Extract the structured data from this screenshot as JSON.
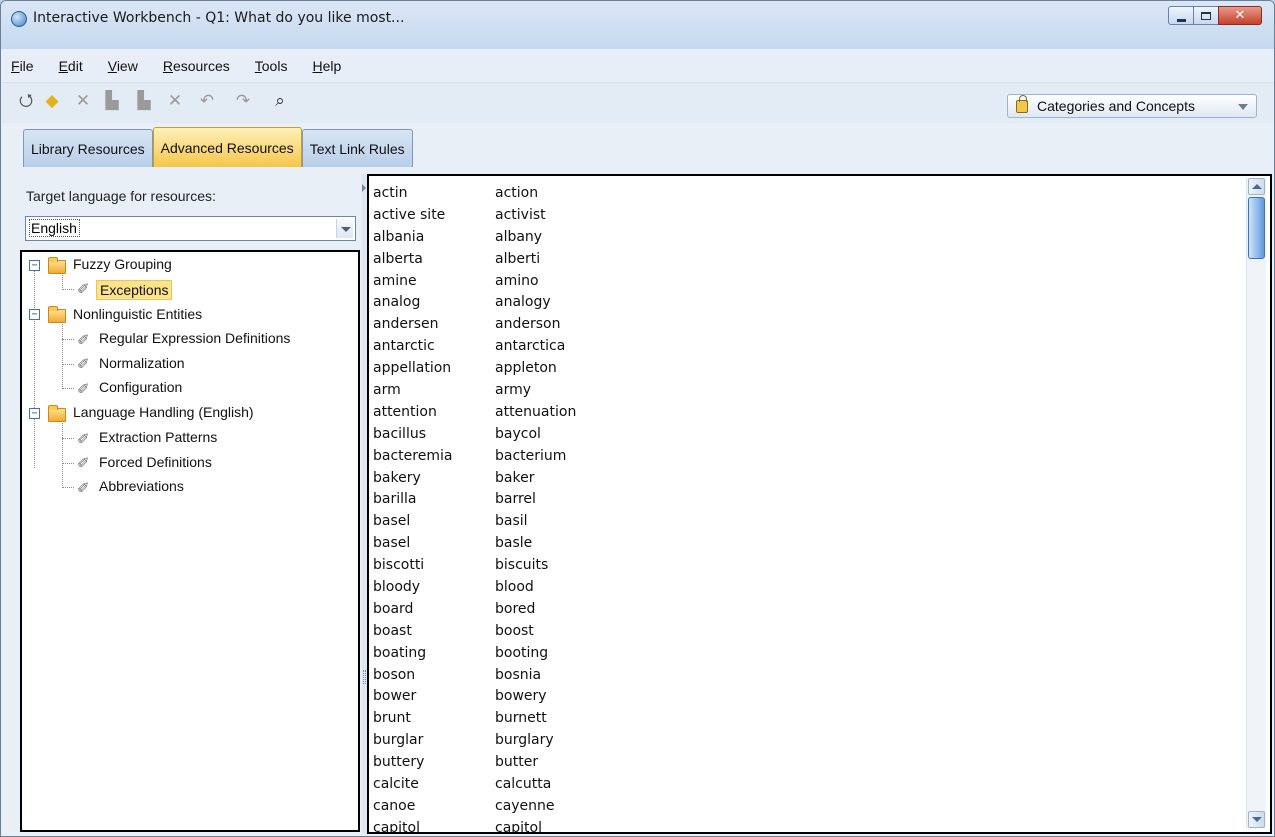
{
  "window": {
    "title": "Interactive Workbench - Q1: What do you like most...",
    "close_glyph": "✕"
  },
  "menu": [
    {
      "label": "File",
      "mnemonic": "F",
      "rest": "ile"
    },
    {
      "label": "Edit",
      "mnemonic": "E",
      "rest": "dit"
    },
    {
      "label": "View",
      "mnemonic": "V",
      "rest": "iew"
    },
    {
      "label": "Resources",
      "mnemonic": "R",
      "rest": "esources"
    },
    {
      "label": "Tools",
      "mnemonic": "T",
      "rest": "ools"
    },
    {
      "label": "Help",
      "mnemonic": "H",
      "rest": "elp"
    }
  ],
  "toolbar": {
    "icons": [
      "new-icon",
      "highlight-icon",
      "cut-icon",
      "copy-icon",
      "paste-icon",
      "delete-icon",
      "undo-icon",
      "redo-icon",
      "find-icon"
    ],
    "view_selector": "Categories and Concepts"
  },
  "tabs": [
    {
      "label": "Library Resources",
      "active": false
    },
    {
      "label": "Advanced Resources",
      "active": true
    },
    {
      "label": "Text Link Rules",
      "active": false
    }
  ],
  "left_panel": {
    "target_language_label": "Target language for resources:",
    "language_value": "English",
    "tree": [
      {
        "label": "Fuzzy Grouping",
        "type": "folder",
        "expander": "−"
      },
      {
        "label": "Exceptions",
        "type": "leaf",
        "selected": true
      },
      {
        "label": "Nonlinguistic Entities",
        "type": "folder",
        "expander": "−"
      },
      {
        "label": "Regular Expression Definitions",
        "type": "leaf"
      },
      {
        "label": "Normalization",
        "type": "leaf"
      },
      {
        "label": "Configuration",
        "type": "leaf"
      },
      {
        "label": "Language Handling (English)",
        "type": "folder",
        "expander": "−"
      },
      {
        "label": "Extraction Patterns",
        "type": "leaf"
      },
      {
        "label": "Forced Definitions",
        "type": "leaf"
      },
      {
        "label": "Abbreviations",
        "type": "leaf"
      }
    ]
  },
  "word_pairs": [
    [
      "actin",
      "action"
    ],
    [
      "active site",
      "activist"
    ],
    [
      "albania",
      "albany"
    ],
    [
      "alberta",
      "alberti"
    ],
    [
      "amine",
      "amino"
    ],
    [
      "analog",
      "analogy"
    ],
    [
      "andersen",
      "anderson"
    ],
    [
      "antarctic",
      "antarctica"
    ],
    [
      "appellation",
      "appleton"
    ],
    [
      "arm",
      "army"
    ],
    [
      "attention",
      "attenuation"
    ],
    [
      "bacillus",
      "baycol"
    ],
    [
      "bacteremia",
      "bacterium"
    ],
    [
      "bakery",
      "baker"
    ],
    [
      "barilla",
      "barrel"
    ],
    [
      "basel",
      "basil"
    ],
    [
      "basel",
      "basle"
    ],
    [
      "biscotti",
      "biscuits"
    ],
    [
      "bloody",
      "blood"
    ],
    [
      "board",
      "bored"
    ],
    [
      "boast",
      "boost"
    ],
    [
      "boating",
      "booting"
    ],
    [
      "boson",
      "bosnia"
    ],
    [
      "bower",
      "bowery"
    ],
    [
      "brunt",
      "burnett"
    ],
    [
      "burglar",
      "burglary"
    ],
    [
      "buttery",
      "butter"
    ],
    [
      "calcite",
      "calcutta"
    ],
    [
      "canoe",
      "cayenne"
    ],
    [
      "capitol",
      "capitol"
    ]
  ]
}
